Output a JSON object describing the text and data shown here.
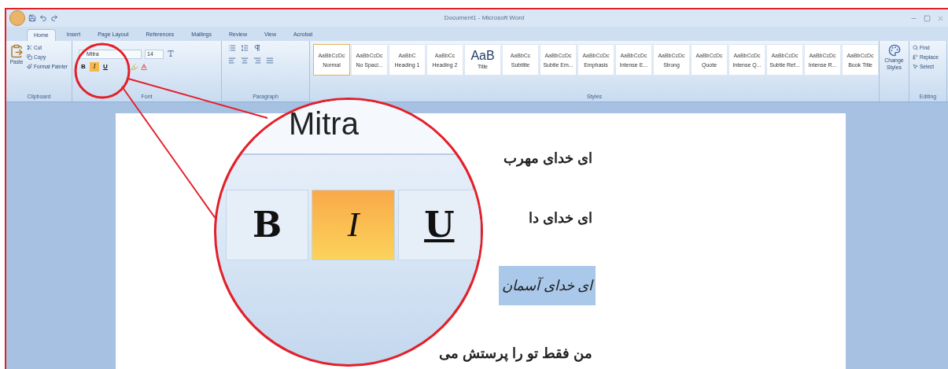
{
  "window": {
    "title": "Document1 - Microsoft Word"
  },
  "tabs": [
    {
      "label": "Home",
      "selected": true
    },
    {
      "label": "Insert",
      "selected": false
    },
    {
      "label": "Page Layout",
      "selected": false
    },
    {
      "label": "References",
      "selected": false
    },
    {
      "label": "Mailings",
      "selected": false
    },
    {
      "label": "Review",
      "selected": false
    },
    {
      "label": "View",
      "selected": false
    },
    {
      "label": "Acrobat",
      "selected": false
    }
  ],
  "ribbon": {
    "clipboard": {
      "label": "Clipboard",
      "paste": "Paste",
      "items": [
        "Cut",
        "Copy",
        "Format Painter"
      ]
    },
    "font": {
      "label": "Font",
      "name": "Mitra",
      "size": "14",
      "format_buttons": [
        {
          "kind": "bold",
          "label": "B",
          "selected": false
        },
        {
          "kind": "italic",
          "label": "I",
          "selected": true
        },
        {
          "kind": "underline",
          "label": "U",
          "selected": false
        }
      ]
    },
    "paragraph": {
      "label": "Paragraph"
    },
    "styles": {
      "label": "Styles",
      "change_styles": "Change Styles",
      "items": [
        {
          "preview": "AaBbCcDc",
          "name": "Normal",
          "kind": "normal",
          "selected": true
        },
        {
          "preview": "AaBbCcDc",
          "name": "No Spaci...",
          "kind": "normal",
          "selected": false
        },
        {
          "preview": "AaBbC",
          "name": "Heading 1",
          "kind": "normal",
          "selected": false
        },
        {
          "preview": "AaBbCc",
          "name": "Heading 2",
          "kind": "normal",
          "selected": false
        },
        {
          "preview": "AaB",
          "name": "Title",
          "kind": "large",
          "selected": false
        },
        {
          "preview": "AaBbCc",
          "name": "Subtitle",
          "kind": "normal",
          "selected": false
        },
        {
          "preview": "AaBbCcDc",
          "name": "Subtle Em...",
          "kind": "normal",
          "selected": false
        },
        {
          "preview": "AaBbCcDc",
          "name": "Emphasis",
          "kind": "normal",
          "selected": false
        },
        {
          "preview": "AaBbCcDc",
          "name": "Intense E...",
          "kind": "normal",
          "selected": false
        },
        {
          "preview": "AaBbCcDc",
          "name": "Strong",
          "kind": "normal",
          "selected": false
        },
        {
          "preview": "AaBbCcDc",
          "name": "Quote",
          "kind": "normal",
          "selected": false
        },
        {
          "preview": "AaBbCcDc",
          "name": "Intense Q...",
          "kind": "normal",
          "selected": false
        },
        {
          "preview": "AaBbCcDc",
          "name": "Subtle Ref...",
          "kind": "normal",
          "selected": false
        },
        {
          "preview": "AaBbCcDc",
          "name": "Intense R...",
          "kind": "normal",
          "selected": false
        },
        {
          "preview": "AaBbCcDc",
          "name": "Book Title",
          "kind": "normal",
          "selected": false
        }
      ]
    },
    "editing": {
      "label": "Editing",
      "items": [
        "Find",
        "Replace",
        "Select"
      ]
    }
  },
  "magnifier": {
    "font_name": "Mitra",
    "format_buttons": [
      {
        "kind": "bold",
        "label": "B",
        "selected": false
      },
      {
        "kind": "italic",
        "label": "I",
        "selected": true
      },
      {
        "kind": "underline",
        "label": "U",
        "selected": false
      }
    ]
  },
  "document": {
    "lines": [
      {
        "text": "ای خدای مهرب",
        "kind": "bold",
        "highlighted": false
      },
      {
        "text": "ای خدای دا",
        "kind": "bold",
        "highlighted": false
      },
      {
        "text": "ای خدای آسمان",
        "kind": "italic",
        "highlighted": true
      },
      {
        "text": "من فقط تو را پرستش می",
        "kind": "bold",
        "highlighted": false
      }
    ]
  }
}
